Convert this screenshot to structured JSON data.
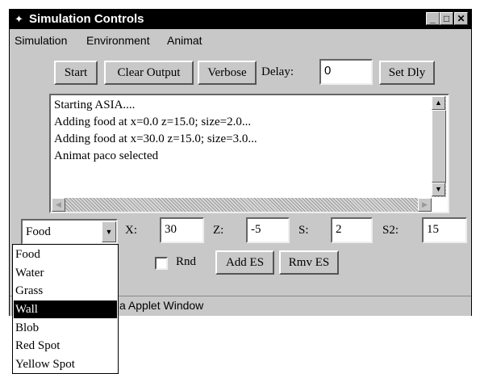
{
  "window": {
    "title": "Simulation Controls"
  },
  "menu": {
    "items": [
      "Simulation",
      "Environment",
      "Animat"
    ]
  },
  "toolbar": {
    "start_label": "Start",
    "clear_label": "Clear Output",
    "verbose_label": "Verbose",
    "delay_label": "Delay:",
    "delay_value": "0",
    "set_delay_label": "Set Dly"
  },
  "output": {
    "lines": [
      "Starting ASIA....",
      "Adding food at x=0.0 z=15.0; size=2.0...",
      "Adding food at x=30.0 z=15.0; size=3.0...",
      "Animat paco selected"
    ]
  },
  "controls": {
    "type_selected": "Food",
    "x_label": "X:",
    "x_value": "30",
    "z_label": "Z:",
    "z_value": "-5",
    "s_label": "S:",
    "s_value": "2",
    "s2_label": "S2:",
    "s2_value": "15",
    "rnd_label": "Rnd",
    "add_label": "Add ES",
    "remove_label": "Rmv ES"
  },
  "status": {
    "text": "a Applet Window"
  },
  "dropdown": {
    "options": [
      "Food",
      "Water",
      "Grass",
      "Wall",
      "Blob",
      "Red Spot",
      "Yellow Spot"
    ],
    "highlighted": "Wall"
  },
  "icons": {
    "app": "applet-icon",
    "minimize": "minimize-icon",
    "maximize": "maximize-icon",
    "close": "close-icon",
    "combo_arrow": "chevron-down-icon"
  }
}
